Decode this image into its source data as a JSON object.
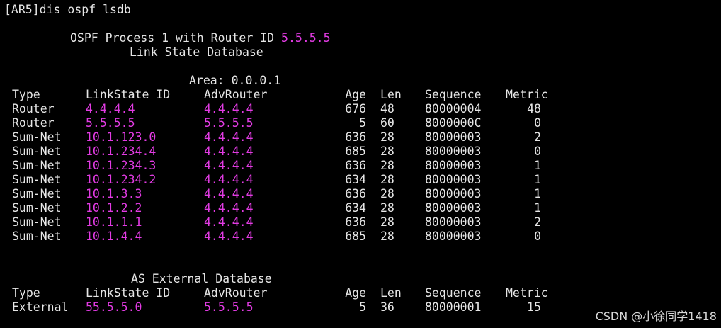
{
  "command_line": "[AR5]dis ospf lsdb",
  "header": {
    "process_prefix": "OSPF Process 1 with Router ID ",
    "router_id": "5.5.5.5",
    "subtitle": "Link State Database"
  },
  "area": {
    "label": "Area: 0.0.0.1",
    "columns": [
      "Type",
      "LinkState ID",
      "AdvRouter",
      "Age",
      "Len",
      "Sequence",
      "Metric"
    ],
    "rows": [
      {
        "type": "Router",
        "lsid": "4.4.4.4",
        "adv": "4.4.4.4",
        "age": "676",
        "len": "48",
        "seq": "80000004",
        "metric": "48"
      },
      {
        "type": "Router",
        "lsid": "5.5.5.5",
        "adv": "5.5.5.5",
        "age": "5",
        "len": "60",
        "seq": "8000000C",
        "metric": "0"
      },
      {
        "type": "Sum-Net",
        "lsid": "10.1.123.0",
        "adv": "4.4.4.4",
        "age": "636",
        "len": "28",
        "seq": "80000003",
        "metric": "2"
      },
      {
        "type": "Sum-Net",
        "lsid": "10.1.234.4",
        "adv": "4.4.4.4",
        "age": "685",
        "len": "28",
        "seq": "80000003",
        "metric": "0"
      },
      {
        "type": "Sum-Net",
        "lsid": "10.1.234.3",
        "adv": "4.4.4.4",
        "age": "636",
        "len": "28",
        "seq": "80000003",
        "metric": "1"
      },
      {
        "type": "Sum-Net",
        "lsid": "10.1.234.2",
        "adv": "4.4.4.4",
        "age": "634",
        "len": "28",
        "seq": "80000003",
        "metric": "1"
      },
      {
        "type": "Sum-Net",
        "lsid": "10.1.3.3",
        "adv": "4.4.4.4",
        "age": "636",
        "len": "28",
        "seq": "80000003",
        "metric": "1"
      },
      {
        "type": "Sum-Net",
        "lsid": "10.1.2.2",
        "adv": "4.4.4.4",
        "age": "634",
        "len": "28",
        "seq": "80000003",
        "metric": "1"
      },
      {
        "type": "Sum-Net",
        "lsid": "10.1.1.1",
        "adv": "4.4.4.4",
        "age": "636",
        "len": "28",
        "seq": "80000003",
        "metric": "2"
      },
      {
        "type": "Sum-Net",
        "lsid": "10.1.4.4",
        "adv": "4.4.4.4",
        "age": "685",
        "len": "28",
        "seq": "80000003",
        "metric": "0"
      }
    ]
  },
  "external": {
    "label": "AS External Database",
    "columns": [
      "Type",
      "LinkState ID",
      "AdvRouter",
      "Age",
      "Len",
      "Sequence",
      "Metric"
    ],
    "rows": [
      {
        "type": "External",
        "lsid": "55.5.5.0",
        "adv": "5.5.5.5",
        "age": "5",
        "len": "36",
        "seq": "80000001",
        "metric": "15"
      }
    ]
  },
  "watermark": "CSDN @小徐同学1418",
  "colors": {
    "background": "#000000",
    "text": "#e6e6e6",
    "highlight": "#e23be3"
  }
}
